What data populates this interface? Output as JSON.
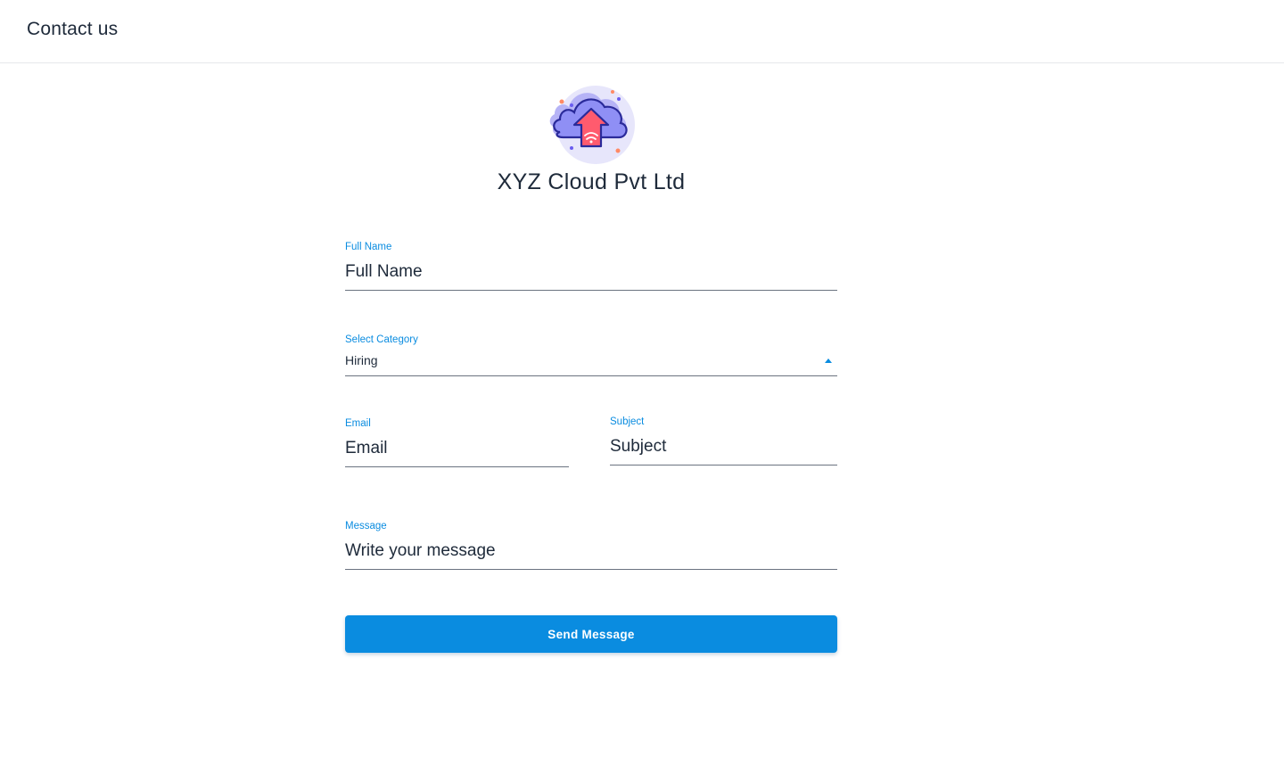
{
  "header": {
    "title": "Contact us"
  },
  "brand": {
    "logo_icon": "cloud-upload-icon",
    "company_name": "XYZ Cloud Pvt Ltd"
  },
  "form": {
    "full_name": {
      "label": "Full Name",
      "placeholder": "Full Name",
      "value": ""
    },
    "category": {
      "label": "Select Category",
      "value": "Hiring",
      "arrow_icon": "caret-up-icon"
    },
    "email": {
      "label": "Email",
      "placeholder": "Email",
      "value": ""
    },
    "subject": {
      "label": "Subject",
      "placeholder": "Subject",
      "value": ""
    },
    "message": {
      "label": "Message",
      "placeholder": "Write your message",
      "value": ""
    },
    "submit_label": "Send Message"
  },
  "colors": {
    "accent": "#0a8ce0",
    "text": "#1e2a3a",
    "underline": "#6b7380",
    "logo_cloud": "#8f8ff5",
    "logo_arrow": "#ff5b6e"
  }
}
